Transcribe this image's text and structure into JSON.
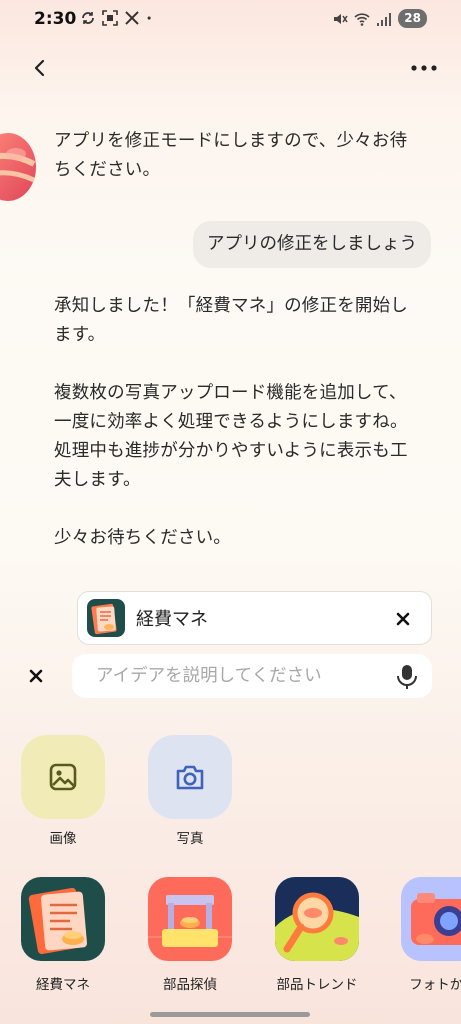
{
  "status_bar": {
    "time": "2:30",
    "battery": "28",
    "icons": [
      "sync-icon",
      "screenshot-icon",
      "x-logo-icon",
      "dot-icon",
      "mute-icon",
      "wifi-icon",
      "signal-icon"
    ]
  },
  "header": {
    "back_icon": "chevron-left-icon",
    "more_icon": "more-horizontal-icon"
  },
  "conversation": [
    {
      "role": "assistant",
      "text": "アプリを修正モードにしますので、少々お待ちください。"
    },
    {
      "role": "user",
      "text": "アプリの修正をしましょう"
    },
    {
      "role": "assistant",
      "paragraphs": [
        "承知しました！「経費マネ」の修正を開始します。",
        "複数枚の写真アップロード機能を追加して、一度に効率よく処理できるようにしますね。処理中も進捗が分かりやすいように表示も工夫します。",
        "少々お待ちください。"
      ]
    }
  ],
  "composer": {
    "attachment_label": "経費マネ",
    "placeholder": "アイデアを説明してください",
    "value": ""
  },
  "attach_options": [
    {
      "label": "画像",
      "icon": "image-icon",
      "color": "#f1ecb7"
    },
    {
      "label": "写真",
      "icon": "camera-icon",
      "color": "#dde3f1"
    }
  ],
  "apps": [
    {
      "label": "経費マネ"
    },
    {
      "label": "部品探偵"
    },
    {
      "label": "部品トレンド"
    },
    {
      "label": "フォトから"
    }
  ],
  "colors": {
    "icon_dark": "#5b5a1e",
    "camera_blue": "#3f63b8"
  }
}
